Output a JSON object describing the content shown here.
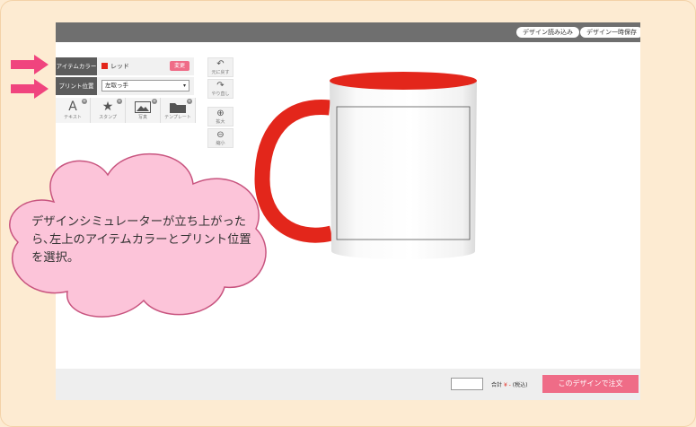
{
  "header": {
    "load_design_label": "デザイン読み込み",
    "save_design_label": "デザイン一時保存"
  },
  "options": {
    "item_color_label": "アイテムカラー",
    "color_name": "レッド",
    "change_label": "変更",
    "print_position_label": "プリント位置",
    "print_position_value": "左取っ手"
  },
  "tools": [
    {
      "label": "テキスト",
      "icon": "text-icon"
    },
    {
      "label": "スタンプ",
      "icon": "stamp-icon"
    },
    {
      "label": "写真",
      "icon": "photo-icon"
    },
    {
      "label": "テンプレート",
      "icon": "folder-icon"
    }
  ],
  "side_tools": [
    {
      "label": "元に戻す",
      "icon": "undo-icon"
    },
    {
      "label": "やり直し",
      "icon": "redo-icon"
    },
    {
      "label": "拡大",
      "icon": "zoom-in-icon"
    },
    {
      "label": "縮小",
      "icon": "zoom-out-icon"
    }
  ],
  "footer": {
    "total_label": "合計",
    "price_text": "¥ -",
    "tax_note": "(税込)",
    "order_label": "このデザインで注文"
  },
  "callout": {
    "text": "デザインシミュレーターが立ち上がったら､左上のアイテムカラーとプリント位置を選択。"
  },
  "colors": {
    "mug_accent": "#e3261b",
    "brand_pink": "#ef6c87",
    "arrow_pink": "#f0447e",
    "cloud_pink": "#fcc4d9"
  }
}
